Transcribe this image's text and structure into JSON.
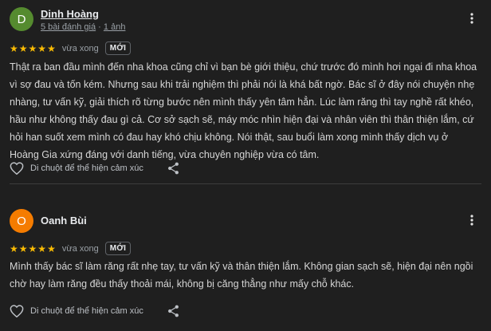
{
  "reviews": [
    {
      "initial": "D",
      "avatar_color": "#558b2f",
      "name": "Dinh Hoàng",
      "review_count": "5 bài đánh giá",
      "separator": " · ",
      "photo_count": "1 ảnh",
      "rating": 5,
      "time": "vừa xong",
      "badge": "MỚI",
      "text": "Thật ra ban đầu mình đến nha khoa cũng chỉ vì bạn bè giới thiệu, chứ trước đó mình hơi ngại đi nha khoa vì sợ đau và tốn kém. Nhưng sau khi trải nghiệm thì phải nói là khá bất ngờ. Bác sĩ ở đây nói chuyện nhẹ nhàng, tư vấn kỹ, giải thích rõ từng bước nên mình thấy yên tâm hẳn. Lúc làm răng thì tay nghề rất khéo, hầu như không thấy đau gì cả. Cơ sở sạch sẽ, máy móc nhìn hiện đại và nhân viên thì thân thiện lắm, cứ hỏi han suốt xem mình có đau hay khó chịu không. Nói thật, sau buổi làm xong mình thấy dịch vụ ở Hoàng Gia xứng đáng với danh tiếng, vừa chuyên nghiệp vừa có tâm.",
      "react_label": "Di chuột để thể hiện cảm xúc"
    },
    {
      "initial": "O",
      "avatar_color": "#f57c00",
      "name": "Oanh Bùi",
      "rating": 5,
      "time": "vừa xong",
      "badge": "MỚI",
      "text": "Mình thấy bác sĩ làm răng rất nhẹ tay, tư vấn kỹ và thân thiện lắm. Không gian sạch sẽ, hiện đại nên ngồi chờ hay làm răng đều thấy thoải mái, không bị căng thẳng như mấy chỗ khác.",
      "react_label": "Di chuột để thể hiện cảm xúc"
    }
  ],
  "icons": {
    "more": "more-vert-icon",
    "heart": "heart-outline-icon",
    "share": "share-icon",
    "star": "star-icon"
  },
  "colors": {
    "background": "#1f1f1f",
    "star": "#fbbc04",
    "muted": "#9aa0a6"
  }
}
